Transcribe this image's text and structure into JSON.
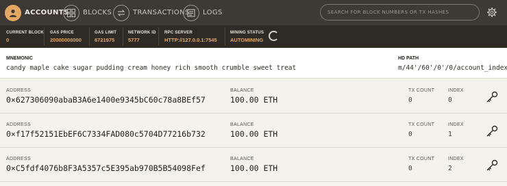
{
  "nav": {
    "accounts": "ACCOUNTS",
    "blocks": "BLOCKS",
    "transactions": "TRANSACTIONS",
    "logs": "LOGS",
    "search_placeholder": "SEARCH FOR BLOCK NUMBERS OR TX HASHES",
    "active_tab": "accounts",
    "accent_color": "#e4a663"
  },
  "status": {
    "current_block_label": "CURRENT BLOCK",
    "current_block": "0",
    "gas_price_label": "GAS PRICE",
    "gas_price": "20000000000",
    "gas_limit_label": "GAS LIMIT",
    "gas_limit": "6721975",
    "network_id_label": "NETWORK ID",
    "network_id": "5777",
    "rpc_server_label": "RPC SERVER",
    "rpc_server": "HTTP://127.0.0.1:7545",
    "mining_status_label": "MINING STATUS",
    "mining_status": "AUTOMINING"
  },
  "mnemonic": {
    "label": "MNEMONIC",
    "value": "candy maple cake sugar pudding cream honey rich smooth crumble sweet treat",
    "hd_path_label": "HD PATH",
    "hd_path": "m/44'/60'/0'/0/account_index"
  },
  "labels": {
    "address": "ADDRESS",
    "balance": "BALANCE",
    "tx_count": "TX COUNT",
    "index": "INDEX"
  },
  "accounts": [
    {
      "address": "0×627306090abaB3A6e1400e9345bC60c78a8BEf57",
      "balance": "100.00 ETH",
      "tx_count": "0",
      "index": "0"
    },
    {
      "address": "0×f17f52151EbEF6C7334FAD080c5704D77216b732",
      "balance": "100.00 ETH",
      "tx_count": "0",
      "index": "1"
    },
    {
      "address": "0×C5fdf4076b8F3A5357c5E395ab970B5B54098Fef",
      "balance": "100.00 ETH",
      "tx_count": "0",
      "index": "2"
    }
  ]
}
